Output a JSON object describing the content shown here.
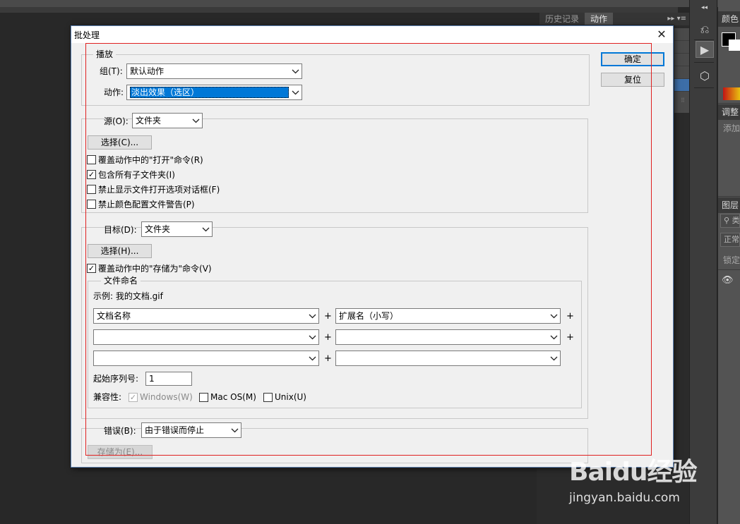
{
  "photoshop": {
    "panel_tabs": [
      "历史记录",
      "动作"
    ],
    "right_panel": {
      "color_header": "颜色",
      "adjust_header": "调整",
      "adjust_add": "添加",
      "layers_header": "图层",
      "layers_search": "类",
      "blend_mode": "正常",
      "lock_label": "锁定"
    }
  },
  "dialog": {
    "title": "批处理",
    "ok_label": "确定",
    "reset_label": "复位",
    "play": {
      "group_title": "播放",
      "set_label": "组(T):",
      "set_value": "默认动作",
      "action_label": "动作:",
      "action_value": "淡出效果（选区）"
    },
    "source": {
      "label": "源(O):",
      "value": "文件夹",
      "choose_label": "选择(C)...",
      "checks": [
        {
          "label": "覆盖动作中的\"打开\"命令(R)",
          "checked": false
        },
        {
          "label": "包含所有子文件夹(I)",
          "checked": true
        },
        {
          "label": "禁止显示文件打开选项对话框(F)",
          "checked": false
        },
        {
          "label": "禁止颜色配置文件警告(P)",
          "checked": false
        }
      ]
    },
    "destination": {
      "label": "目标(D):",
      "value": "文件夹",
      "choose_label": "选择(H)...",
      "override_label": "覆盖动作中的\"存储为\"命令(V)",
      "override_checked": true,
      "naming": {
        "group_title": "文件命名",
        "example": "示例: 我的文档.gif",
        "rows": [
          [
            "文档名称",
            "扩展名（小写）"
          ],
          [
            "",
            ""
          ],
          [
            "",
            ""
          ]
        ],
        "plus": "+",
        "serial_label": "起始序列号:",
        "serial_value": "1",
        "compat_label": "兼容性:",
        "compat": [
          {
            "label": "Windows(W)",
            "checked": true,
            "disabled": true
          },
          {
            "label": "Mac OS(M)",
            "checked": false,
            "disabled": false
          },
          {
            "label": "Unix(U)",
            "checked": false,
            "disabled": false
          }
        ]
      }
    },
    "errors": {
      "label": "错误(B):",
      "value": "由于错误而停止",
      "save_as_label": "存储为(E)..."
    }
  },
  "watermark": {
    "logo_text": "Baidu经验",
    "url": "jingyan.baidu.com"
  },
  "colors": {
    "accent": "#0078d7",
    "annotation": "#e02020"
  }
}
